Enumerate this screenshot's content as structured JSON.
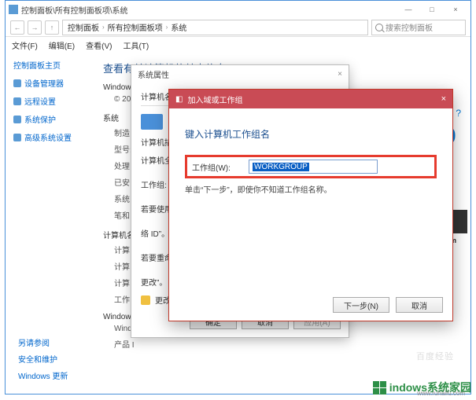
{
  "main_window": {
    "title": "控制面板\\所有控制面板项\\系统",
    "win_min": "—",
    "win_max": "□",
    "win_close": "×",
    "nav_back": "←",
    "nav_fwd": "→",
    "nav_up": "↑",
    "breadcrumb": [
      "控制面板",
      "所有控制面板项",
      "系统"
    ],
    "bc_sep": "›",
    "search_placeholder": "搜索控制面板",
    "help_icon": "?"
  },
  "menubar": [
    "文件(F)",
    "编辑(E)",
    "查看(V)",
    "工具(T)"
  ],
  "sidebar": {
    "header": "控制面板主页",
    "items": [
      "设备管理器",
      "远程设置",
      "系统保护",
      "高级系统设置"
    ],
    "footer_items": [
      "另请参阅",
      "安全和维护",
      "Windows 更新"
    ]
  },
  "content": {
    "header": "查看有关计算机的基本信息",
    "section1_label": "Windows",
    "section1_sub": "© 201",
    "section2_label": "系统",
    "section2_items": [
      "制造",
      "型号:",
      "处理",
      "已安",
      "系统",
      "笔和"
    ],
    "section3_label": "计算机名",
    "section3_items": [
      "计算",
      "计算",
      "计算",
      "工作"
    ],
    "section4_label": "Windows",
    "section4_items": [
      "Wind",
      "产品 I"
    ],
    "right_badge": "0",
    "right_txt": "tem"
  },
  "dialog1": {
    "title": "系统属性",
    "close": "×",
    "tab": "计算机名",
    "desc_label": "计算机描述",
    "lines": [
      "计算机全称",
      "工作组:",
      "若要使用内",
      "络 ID”。",
      "若要重命名这",
      "更改”。"
    ],
    "change_btn": "更改",
    "btn_ok": "确定",
    "btn_cancel": "取消",
    "btn_apply": "应用(A)"
  },
  "dialog2": {
    "icon": "◧",
    "title": "加入域或工作组",
    "close": "×",
    "heading": "键入计算机工作组名",
    "label": "工作组(W):",
    "input_value": "WORKGROUP",
    "hint": "单击“下一步”，即使你不知道工作组名称。",
    "btn_next": "下一步(N)",
    "btn_cancel": "取消"
  },
  "watermark": {
    "text": "indows系统家园",
    "sub": "www.ruhaifu.com"
  },
  "faint": "百度经验"
}
